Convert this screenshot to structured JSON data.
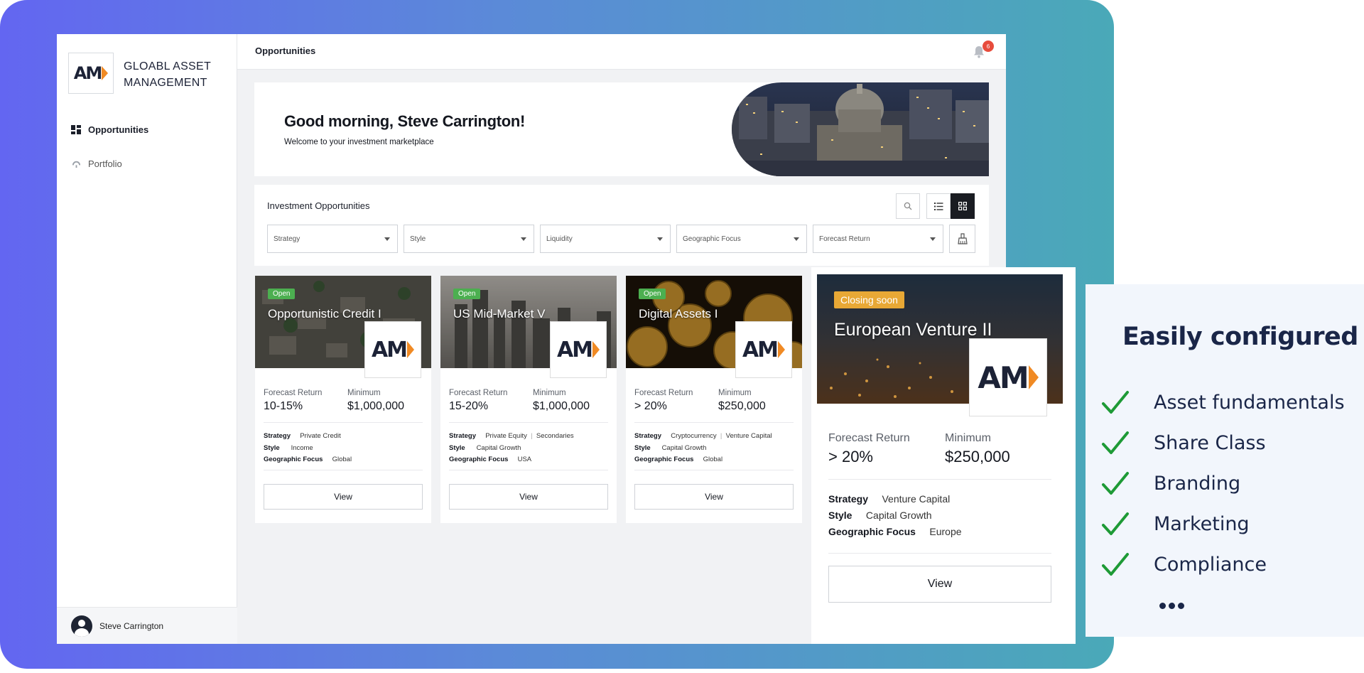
{
  "brand": {
    "name": "GLOABL ASSET MANAGEMENT",
    "logo_text": "AM",
    "icon": "am-logo"
  },
  "sidebar": {
    "items": [
      {
        "label": "Opportunities",
        "icon": "dashboard-icon",
        "active": true
      },
      {
        "label": "Portfolio",
        "icon": "portfolio-icon",
        "active": false
      }
    ],
    "user": {
      "name": "Steve Carrington",
      "icon": "avatar-icon"
    }
  },
  "topbar": {
    "title": "Opportunities",
    "notification_count": "6",
    "icon": "bell-icon"
  },
  "hero": {
    "greeting": "Good morning, Steve Carrington!",
    "subtitle": "Welcome to your investment marketplace"
  },
  "filters": {
    "title": "Investment Opportunities",
    "selects": [
      "Strategy",
      "Style",
      "Liquidity",
      "Geographic Focus",
      "Forecast Return"
    ],
    "tools": [
      "search-icon",
      "list-view-icon",
      "grid-view-icon",
      "clear-filter-icon"
    ]
  },
  "labels": {
    "forecast": "Forecast Return",
    "minimum": "Minimum",
    "strategy": "Strategy",
    "style": "Style",
    "geo": "Geographic Focus",
    "view": "View"
  },
  "cards": [
    {
      "status": "Open",
      "title": "Opportunistic Credit I",
      "forecast": "10-15%",
      "minimum": "$1,000,000",
      "strategy": [
        "Private Credit"
      ],
      "style": "Income",
      "geo": "Global"
    },
    {
      "status": "Open",
      "title": "US Mid-Market V",
      "forecast": "15-20%",
      "minimum": "$1,000,000",
      "strategy": [
        "Private Equity",
        "Secondaries"
      ],
      "style": "Capital Growth",
      "geo": "USA"
    },
    {
      "status": "Open",
      "title": "Digital Assets I",
      "forecast": "> 20%",
      "minimum": "$250,000",
      "strategy": [
        "Cryptocurrency",
        "Venture Capital"
      ],
      "style": "Capital Growth",
      "geo": "Global"
    },
    {
      "status": "Closing soon",
      "title": "European Venture II",
      "forecast": "> 20%",
      "minimum": "$250,000",
      "strategy": [
        "Venture Capital"
      ],
      "style": "Capital Growth",
      "geo": "Europe"
    }
  ],
  "config_panel": {
    "title": "Easily configured",
    "items": [
      "Asset fundamentals",
      "Share Class",
      "Branding",
      "Marketing",
      "Compliance"
    ],
    "more": "..."
  },
  "colors": {
    "gradient_start": "#6366f1",
    "gradient_end": "#4aa9b8",
    "open_badge": "#4caf50",
    "closing_badge": "#e8a835",
    "check": "#1e9a36",
    "navy": "#1a2648"
  }
}
